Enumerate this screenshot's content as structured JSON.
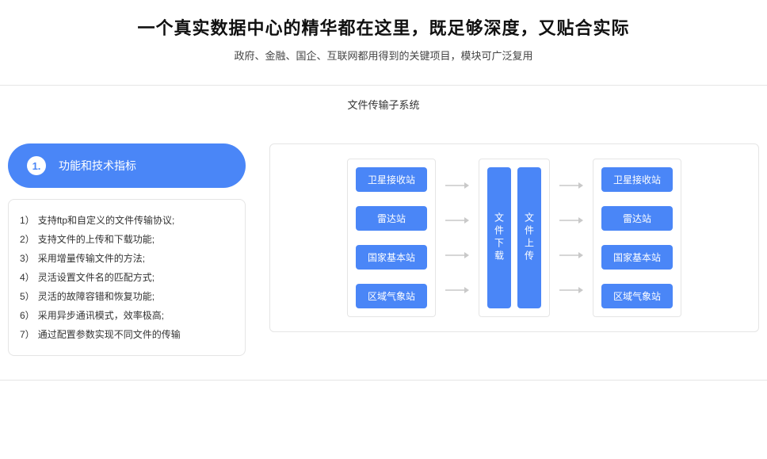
{
  "header": {
    "title": "一个真实数据中心的精华都在这里，既足够深度，又贴合实际",
    "subtitle": "政府、金融、国企、互联网都用得到的关键项目，模块可广泛复用"
  },
  "panel": {
    "title": "文件传输子系统"
  },
  "tab": {
    "number": "1.",
    "label": "功能和技术指标"
  },
  "features": [
    {
      "num": "1）",
      "text": "支持ftp和自定义的文件传输协议;"
    },
    {
      "num": "2）",
      "text": "支持文件的上传和下载功能;"
    },
    {
      "num": "3）",
      "text": "采用增量传输文件的方法;"
    },
    {
      "num": "4）",
      "text": "灵活设置文件名的匹配方式;"
    },
    {
      "num": "5）",
      "text": "灵活的故障容错和恢复功能;"
    },
    {
      "num": "6）",
      "text": "采用异步通讯模式，效率极高;"
    },
    {
      "num": "7）",
      "text": "通过配置参数实现不同文件的传输"
    }
  ],
  "diagram": {
    "left_nodes": [
      "卫星接收站",
      "雷达站",
      "国家基本站",
      "区域气象站"
    ],
    "center": {
      "download": "文件下载",
      "upload": "文件上传"
    },
    "right_nodes": [
      "卫星接收站",
      "雷达站",
      "国家基本站",
      "区域气象站"
    ]
  }
}
